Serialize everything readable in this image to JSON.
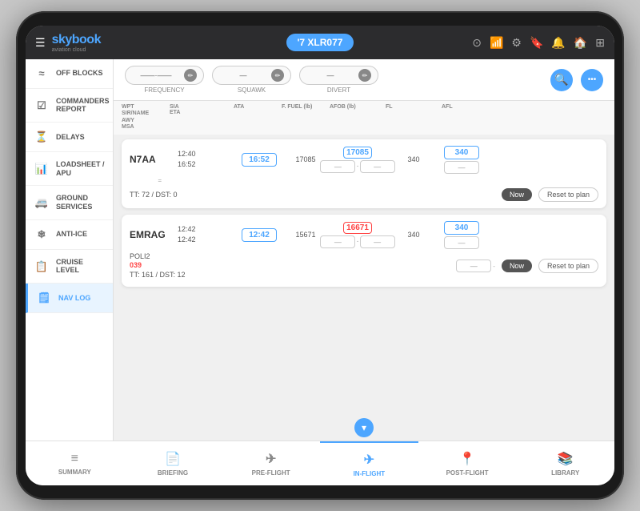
{
  "app": {
    "name": "skybook",
    "sub": "aviation cloud",
    "flight_id": "'7 XLR077"
  },
  "header": {
    "icons": [
      "⊙",
      "📶",
      "⚙",
      "🔖",
      "🔔",
      "🏠",
      "⊞"
    ]
  },
  "sidebar": {
    "items": [
      {
        "id": "off-blocks",
        "label": "OFF BLOCKS",
        "icon": "≈"
      },
      {
        "id": "commanders-report",
        "label": "COMMANDERS REPORT",
        "icon": "☑"
      },
      {
        "id": "delays",
        "label": "DELAYS",
        "icon": "⏳"
      },
      {
        "id": "loadsheet-apu",
        "label": "LOADSHEET / APU",
        "icon": "📊"
      },
      {
        "id": "ground-services",
        "label": "GROUND SERVICES",
        "icon": "🚐"
      },
      {
        "id": "anti-ice",
        "label": "ANTI-ICE",
        "icon": "❄"
      },
      {
        "id": "cruise-level",
        "label": "CRUISE LEVEL",
        "icon": "📋"
      },
      {
        "id": "nav-log",
        "label": "NAV LOG",
        "icon": "🗒",
        "active": true
      }
    ]
  },
  "controls": {
    "frequency": {
      "label": "FREQUENCY",
      "value": "—·—/—·—",
      "placeholder": "——/——"
    },
    "squawk": {
      "label": "SQUAWK",
      "value": "—"
    },
    "divert": {
      "label": "DIVERT",
      "value": "—"
    }
  },
  "table_headers": [
    "WPT\nSIR/NANE\nAWY\nMSA",
    "SIA\nETA",
    "ATA",
    "F. FUEL (lb)",
    "AFOB (lb)",
    "FL",
    "AFL"
  ],
  "nav_entries": [
    {
      "waypoint": "N7AA",
      "times": {
        "plan": "12:40",
        "actual": "16:52"
      },
      "ata_input": "16:52",
      "fuel_plan": "17085",
      "fuel_afob": "17085",
      "fl": "340",
      "afl_input": "340",
      "tt_dst": "TT: 72 / DST: 0",
      "sub_info": "",
      "red_text": ""
    },
    {
      "waypoint": "EMRAG",
      "times": {
        "plan": "12:42",
        "actual": "12:42"
      },
      "ata_input": "12:42",
      "fuel_plan": "15671",
      "fuel_afob": "16671",
      "fl": "340",
      "afl_input": "340",
      "tt_dst": "TT: 161 / DST: 12",
      "sub_info": "POLI2",
      "red_text": "039"
    }
  ],
  "bottom_nav": {
    "items": [
      {
        "id": "summary",
        "label": "SUMMARY",
        "icon": "≡",
        "active": false
      },
      {
        "id": "briefing",
        "label": "BRIEFING",
        "icon": "📄",
        "active": false
      },
      {
        "id": "pre-flight",
        "label": "PRE-FLIGHT",
        "icon": "✈",
        "active": false
      },
      {
        "id": "in-flight",
        "label": "IN-FLIGHT",
        "icon": "✈",
        "active": true
      },
      {
        "id": "post-flight",
        "label": "POST-FLIGHT",
        "icon": "📍",
        "active": false
      },
      {
        "id": "library",
        "label": "LIBRARY",
        "icon": "📚",
        "active": false
      }
    ]
  },
  "buttons": {
    "now": "Now",
    "reset_to_plan": "Reset to plan",
    "search": "🔍",
    "more": "•••"
  }
}
